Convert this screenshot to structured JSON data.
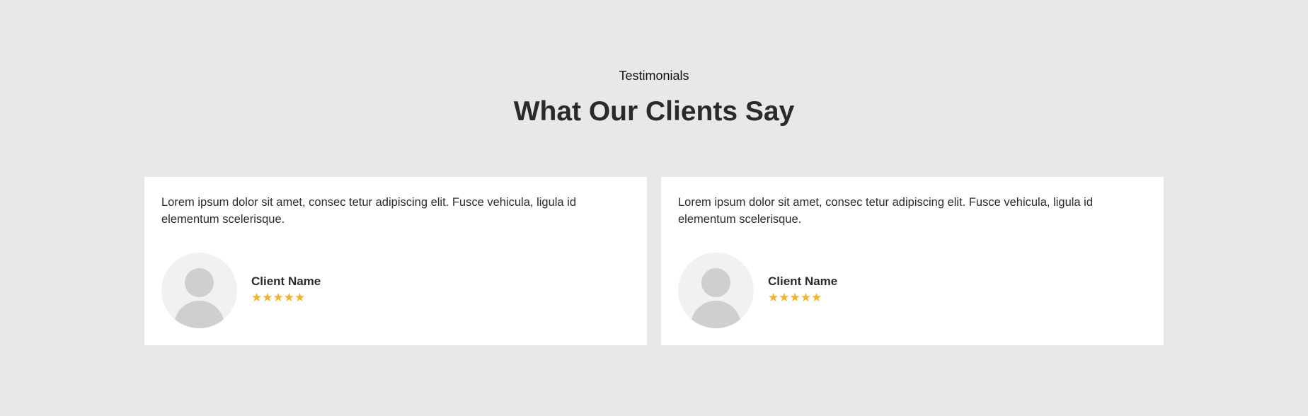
{
  "section": {
    "eyebrow": "Testimonials",
    "title": "What Our Clients Say"
  },
  "testimonials": [
    {
      "quote": "Lorem ipsum dolor sit amet, consec tetur adipiscing elit. Fusce vehicula, ligula id elementum scelerisque.",
      "client_name": "Client Name",
      "rating": 5,
      "stars": "★★★★★",
      "avatar_icon": "user-placeholder-icon"
    },
    {
      "quote": "Lorem ipsum dolor sit amet, consec tetur adipiscing elit. Fusce vehicula, ligula id elementum scelerisque.",
      "client_name": "Client Name",
      "rating": 5,
      "stars": "★★★★★",
      "avatar_icon": "user-placeholder-icon"
    }
  ],
  "colors": {
    "background": "#e8e8e8",
    "card": "#ffffff",
    "star": "#f0b429",
    "heading": "#2a2a2a",
    "avatar_bg": "#f1f1f1",
    "avatar_fg": "#cfcfcf"
  }
}
